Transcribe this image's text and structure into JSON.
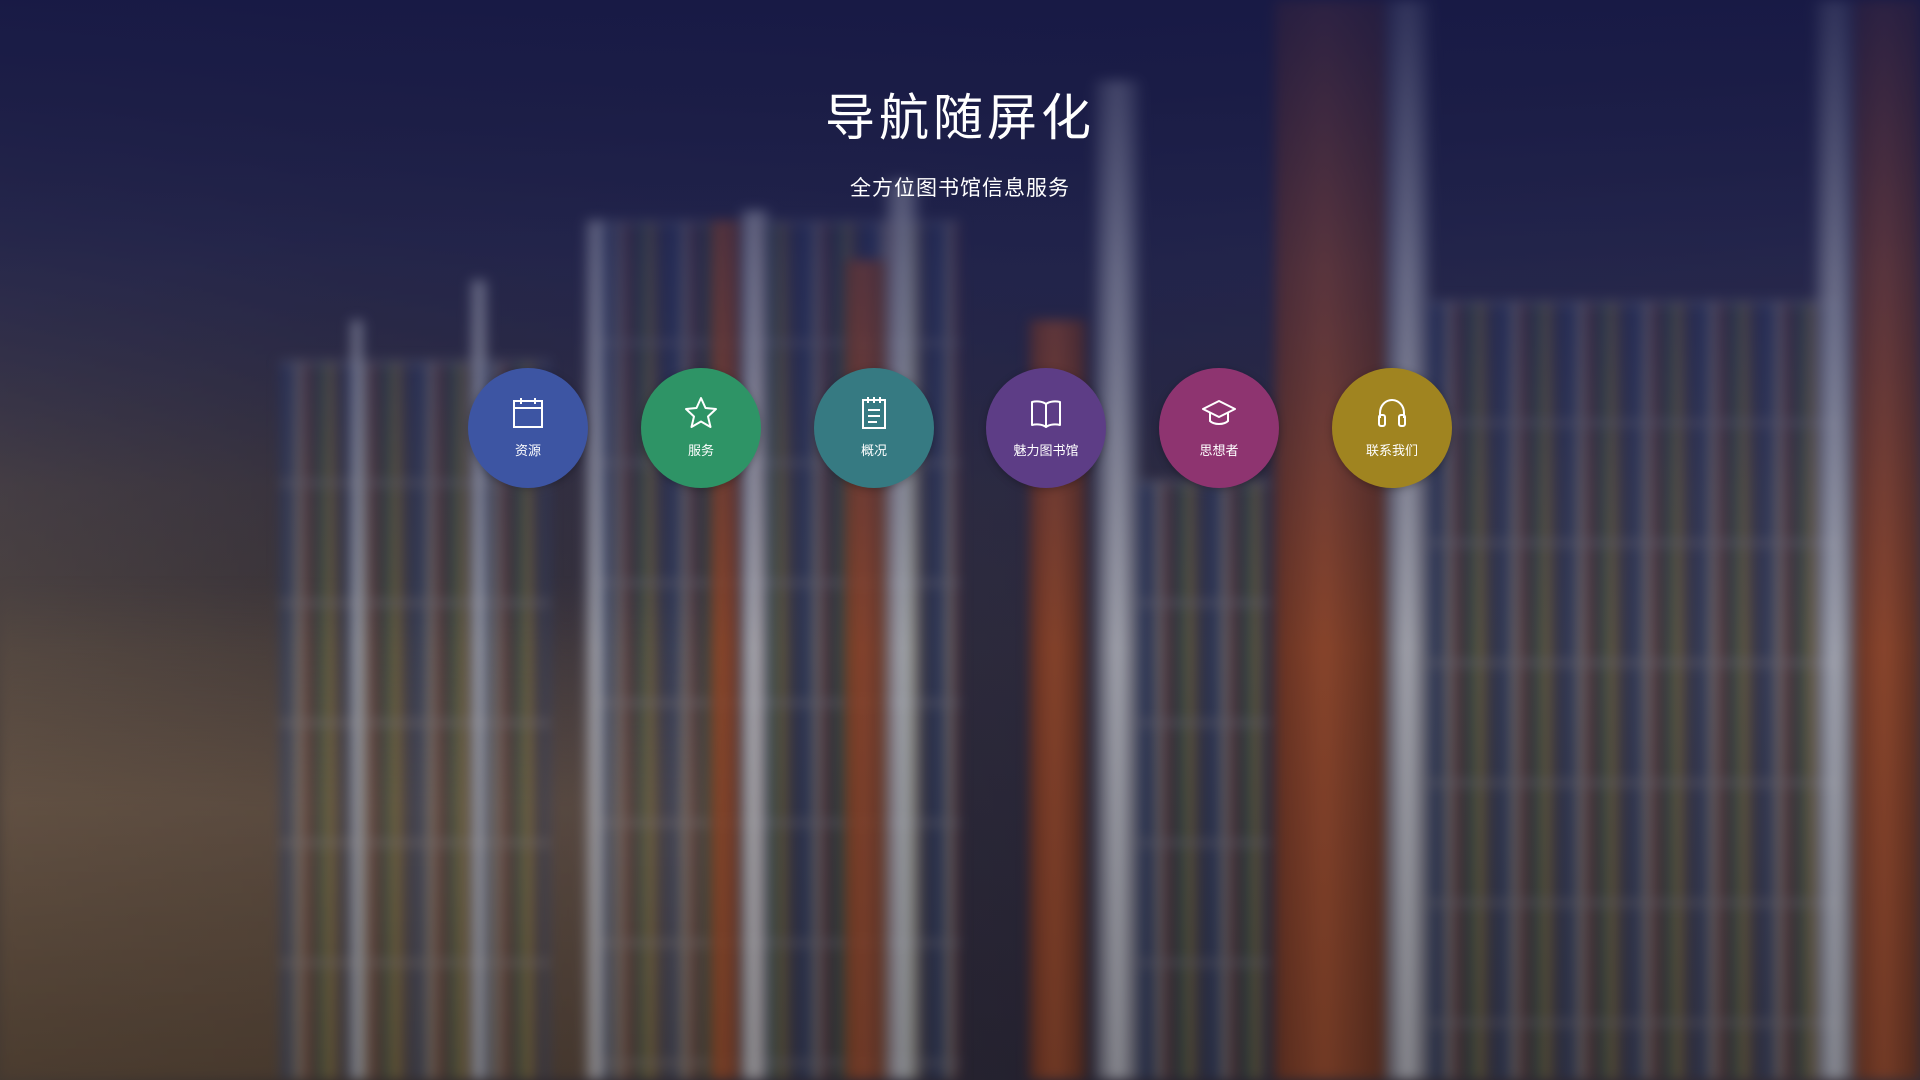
{
  "header": {
    "title": "导航随屏化",
    "subtitle": "全方位图书馆信息服务"
  },
  "nav": {
    "items": [
      {
        "label": "资源",
        "icon": "calendar-icon",
        "color": "#3d55a3"
      },
      {
        "label": "服务",
        "icon": "star-icon",
        "color": "#2e9466"
      },
      {
        "label": "概况",
        "icon": "notepad-icon",
        "color": "#367a82"
      },
      {
        "label": "魅力图书馆",
        "icon": "book-icon",
        "color": "#5d3d86"
      },
      {
        "label": "思想者",
        "icon": "graduation-cap-icon",
        "color": "#8e3470"
      },
      {
        "label": "联系我们",
        "icon": "headphones-icon",
        "color": "#a08420"
      }
    ]
  }
}
